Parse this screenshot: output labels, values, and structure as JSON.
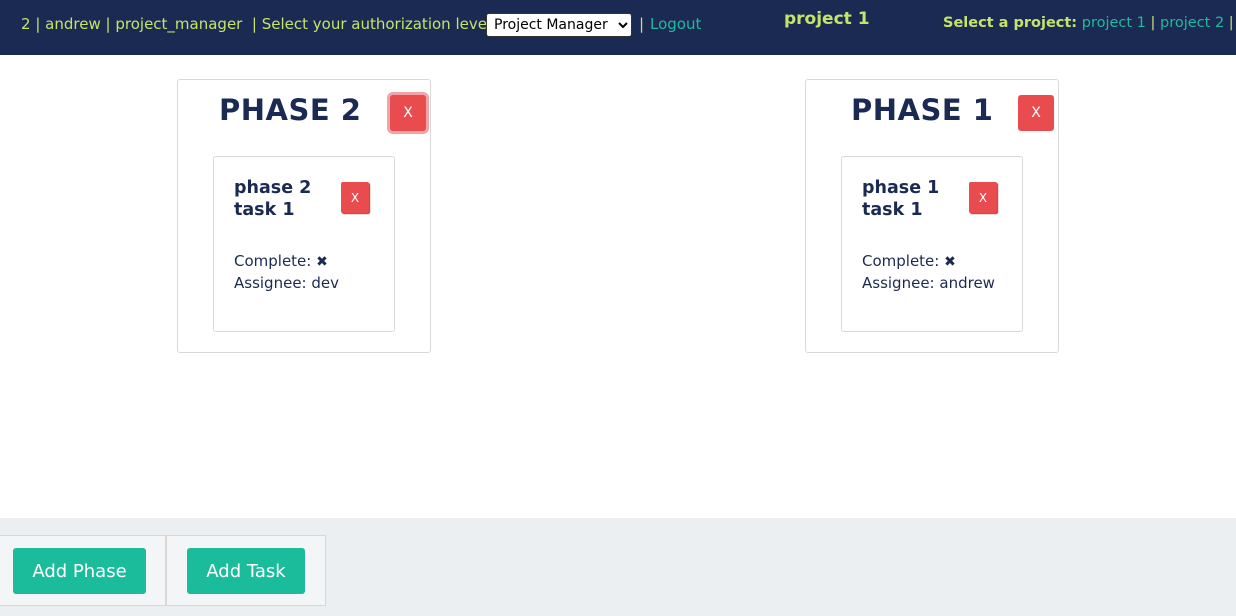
{
  "header": {
    "user_id": "2",
    "username": "andrew",
    "role": "project_manager",
    "auth_label": "Select your authorization level:",
    "auth_value": "Project Manager",
    "separator": "|",
    "logout": "Logout",
    "current_project": "project 1",
    "select_project_label": "Select a project:",
    "projects": [
      "project 1",
      "project 2"
    ]
  },
  "phases": [
    {
      "title": "PHASE 2",
      "delete_label": "X",
      "task": {
        "title": "phase 2 task 1",
        "delete_label": "X",
        "complete_label": "Complete:",
        "complete_icon": "✖",
        "assignee_label": "Assignee:",
        "assignee": "dev"
      }
    },
    {
      "title": "PHASE 1",
      "delete_label": "X",
      "task": {
        "title": "phase 1 task 1",
        "delete_label": "X",
        "complete_label": "Complete:",
        "complete_icon": "✖",
        "assignee_label": "Assignee:",
        "assignee": "andrew"
      }
    }
  ],
  "actions": {
    "add_phase": "Add Phase",
    "add_task": "Add Task"
  },
  "colors": {
    "navbar": "#1b2a52",
    "accent_lime": "#c5e46a",
    "link_teal": "#20b9a0",
    "danger": "#e84c4f",
    "primary_button": "#1abc9c"
  }
}
